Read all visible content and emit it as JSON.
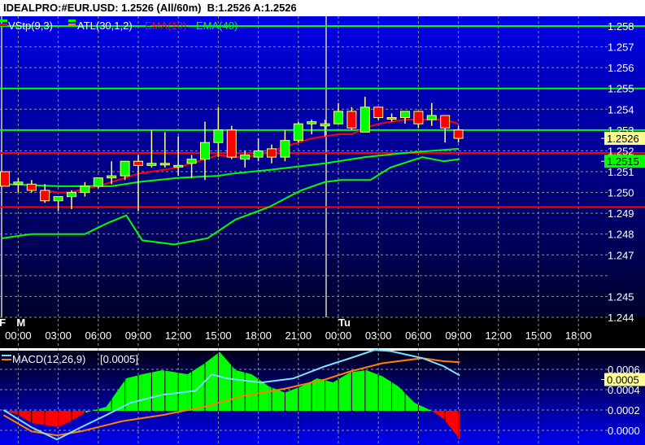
{
  "title": "IDEALPRO:#EUR.USD: 1.2526 (All/60m)  B:1.2526 A:1.2526",
  "legend": {
    "vstp": "VStp(9,3)",
    "atl": "ATL(30,1,2)",
    "ema10": "EMA(10)",
    "ema40": "EMA(40)"
  },
  "colors": {
    "bull": "#00ff00",
    "bear": "#ff0000",
    "wick": "#ffff80",
    "ema10": "#ff0000",
    "green_line": "#00ff00",
    "macd": "#80e0ff",
    "signal": "#ff8000",
    "price_tag": "#ffff90",
    "atl_tag": "#00ff00"
  },
  "price_axis": {
    "labels": [
      "1.258",
      "1.257",
      "1.256",
      "1.255",
      "1.254",
      "1.253",
      "1.252",
      "1.251",
      "1.250",
      "1.249",
      "1.248",
      "1.247",
      "1.245",
      "1.244"
    ],
    "range": [
      1.244,
      1.258
    ],
    "current_price": "1.2526",
    "atl_value": "1.2515"
  },
  "hlines": [
    {
      "price": 1.258,
      "color": "#00ff00"
    },
    {
      "price": 1.255,
      "color": "#00ff00"
    },
    {
      "price": 1.253,
      "color": "#00ff00"
    },
    {
      "price": 1.2519,
      "color": "#ff0000"
    },
    {
      "price": 1.2493,
      "color": "#ff0000"
    }
  ],
  "time_axis": {
    "day_markers": [
      {
        "label": "F",
        "idx": -0.3
      },
      {
        "label": "M",
        "idx": 1
      },
      {
        "label": "Tu",
        "idx": 25
      }
    ],
    "labels": [
      {
        "t": "00:00",
        "idx": 1
      },
      {
        "t": "03:00",
        "idx": 4
      },
      {
        "t": "06:00",
        "idx": 7
      },
      {
        "t": "09:00",
        "idx": 10
      },
      {
        "t": "12:00",
        "idx": 13
      },
      {
        "t": "15:00",
        "idx": 16
      },
      {
        "t": "18:00",
        "idx": 19
      },
      {
        "t": "21:00",
        "idx": 22
      },
      {
        "t": "00:00",
        "idx": 25
      },
      {
        "t": "03:00",
        "idx": 28
      },
      {
        "t": "06:00",
        "idx": 31
      },
      {
        "t": "09:00",
        "idx": 34
      },
      {
        "t": "12:00",
        "idx": 37
      },
      {
        "t": "15:00",
        "idx": 40
      },
      {
        "t": "18:00",
        "idx": 43
      }
    ]
  },
  "candles": [
    [
      1.251,
      1.251,
      1.2503,
      1.2503
    ],
    [
      1.2504,
      1.2507,
      1.25,
      1.2505
    ],
    [
      1.2504,
      1.2506,
      1.25,
      1.2501
    ],
    [
      1.2501,
      1.2504,
      1.2495,
      1.2496
    ],
    [
      1.2496,
      1.2498,
      1.2491,
      1.2498
    ],
    [
      1.2498,
      1.2501,
      1.2492,
      1.25
    ],
    [
      1.25,
      1.2505,
      1.2498,
      1.2503
    ],
    [
      1.2503,
      1.2507,
      1.2502,
      1.2507
    ],
    [
      1.2507,
      1.2515,
      1.2504,
      1.2508
    ],
    [
      1.2508,
      1.2515,
      1.2506,
      1.2515
    ],
    [
      1.2515,
      1.2518,
      1.2491,
      1.2513
    ],
    [
      1.2513,
      1.253,
      1.2512,
      1.2514
    ],
    [
      1.2514,
      1.2529,
      1.2512,
      1.2514
    ],
    [
      1.2513,
      1.2527,
      1.2508,
      1.2513
    ],
    [
      1.2514,
      1.2518,
      1.2507,
      1.2516
    ],
    [
      1.2516,
      1.2534,
      1.2506,
      1.2524
    ],
    [
      1.2524,
      1.2541,
      1.2517,
      1.253
    ],
    [
      1.253,
      1.2532,
      1.2516,
      1.2517
    ],
    [
      1.2516,
      1.252,
      1.2512,
      1.2518
    ],
    [
      1.2517,
      1.2526,
      1.2515,
      1.252
    ],
    [
      1.2521,
      1.2523,
      1.2514,
      1.2517
    ],
    [
      1.2517,
      1.253,
      1.2515,
      1.2525
    ],
    [
      1.2525,
      1.2534,
      1.2524,
      1.2533
    ],
    [
      1.2533,
      1.2535,
      1.2528,
      1.2534
    ],
    [
      1.2532,
      1.2535,
      1.2527,
      1.2533
    ],
    [
      1.2533,
      1.2543,
      1.2533,
      1.2539
    ],
    [
      1.2539,
      1.2541,
      1.253,
      1.2531
    ],
    [
      1.2529,
      1.2546,
      1.2529,
      1.2541
    ],
    [
      1.2541,
      1.2541,
      1.2535,
      1.2536
    ],
    [
      1.2536,
      1.2538,
      1.2534,
      1.2536
    ],
    [
      1.2536,
      1.2539,
      1.2533,
      1.2539
    ],
    [
      1.2539,
      1.2539,
      1.2531,
      1.2533
    ],
    [
      1.2535,
      1.2543,
      1.2532,
      1.2537
    ],
    [
      1.2537,
      1.2537,
      1.2524,
      1.2531
    ],
    [
      1.253,
      1.2532,
      1.2524,
      1.2526
    ]
  ],
  "ema10": [
    [
      3,
      1.2501
    ],
    [
      4,
      1.25
    ],
    [
      5,
      1.25
    ],
    [
      6,
      1.2502
    ],
    [
      7,
      1.2503
    ],
    [
      8,
      1.2505
    ],
    [
      9,
      1.2507
    ],
    [
      10,
      1.2509
    ],
    [
      11,
      1.251
    ],
    [
      12,
      1.2511
    ],
    [
      13,
      1.2512
    ],
    [
      14,
      1.2514
    ],
    [
      15,
      1.2516
    ],
    [
      16,
      1.2518
    ],
    [
      17,
      1.2517
    ],
    [
      18,
      1.2517
    ],
    [
      19,
      1.2518
    ],
    [
      20,
      1.252
    ],
    [
      21,
      1.2522
    ],
    [
      22,
      1.2524
    ],
    [
      23,
      1.2526
    ],
    [
      24,
      1.2527
    ],
    [
      25,
      1.2528
    ],
    [
      26,
      1.2528
    ],
    [
      27,
      1.2531
    ],
    [
      28,
      1.2533
    ],
    [
      29,
      1.2534
    ],
    [
      30,
      1.2535
    ],
    [
      31,
      1.2535
    ],
    [
      32,
      1.2535
    ],
    [
      33,
      1.2535
    ],
    [
      34,
      1.2533
    ]
  ],
  "ema40": [
    [
      0,
      1.2504
    ],
    [
      4,
      1.2503
    ],
    [
      8,
      1.2503
    ],
    [
      10,
      1.2505
    ],
    [
      13,
      1.2507
    ],
    [
      16,
      1.2508
    ],
    [
      17,
      1.2509
    ],
    [
      20,
      1.2511
    ],
    [
      24,
      1.2514
    ],
    [
      27,
      1.2517
    ],
    [
      30,
      1.2519
    ],
    [
      32,
      1.252
    ],
    [
      34,
      1.2521
    ]
  ],
  "vstp": [
    [
      -0.2,
      1.2478
    ],
    [
      2,
      1.248
    ],
    [
      6,
      1.248
    ],
    [
      7.6,
      1.2485
    ],
    [
      9.1,
      1.2489
    ],
    [
      10.3,
      1.2477
    ],
    [
      12.7,
      1.2475
    ],
    [
      15.2,
      1.2478
    ],
    [
      17.3,
      1.2487
    ],
    [
      19.8,
      1.2493
    ],
    [
      22.2,
      1.2501
    ],
    [
      24,
      1.2505
    ],
    [
      25.2,
      1.2506
    ],
    [
      27.4,
      1.2506
    ],
    [
      28.9,
      1.2512
    ],
    [
      31.3,
      1.2517
    ],
    [
      32.9,
      1.2515
    ],
    [
      34.1,
      1.2516
    ]
  ],
  "macd": {
    "label": "MACD(12,26,9)",
    "value": "[0.0005]",
    "axis_labels": [
      "0.0006",
      "0.0004",
      "0.0002",
      "0.0000"
    ],
    "current": "0.0005",
    "range": [
      0.0,
      0.0006
    ],
    "histogram": [
      [
        0,
        0.0
      ],
      [
        1,
        -4e-05
      ],
      [
        2,
        -0.00012
      ],
      [
        4,
        -0.00016
      ],
      [
        5,
        -0.0001
      ],
      [
        6,
        -2e-05
      ],
      [
        7.6,
        4e-05
      ],
      [
        9.1,
        0.00032
      ],
      [
        10.3,
        0.00036
      ],
      [
        11.8,
        0.0004
      ],
      [
        13.7,
        0.00036
      ],
      [
        14.9,
        0.00046
      ],
      [
        16.1,
        0.00058
      ],
      [
        17.3,
        0.0004
      ],
      [
        18.5,
        0.00036
      ],
      [
        19.8,
        0.00024
      ],
      [
        21,
        0.00018
      ],
      [
        22.2,
        0.00024
      ],
      [
        23.4,
        0.00032
      ],
      [
        24.6,
        0.00028
      ],
      [
        25.9,
        0.00038
      ],
      [
        27.1,
        0.0004
      ],
      [
        28.3,
        0.00034
      ],
      [
        29.5,
        0.00024
      ],
      [
        30.7,
        8e-05
      ],
      [
        32,
        0.0
      ],
      [
        32.9,
        -8e-05
      ],
      [
        34.1,
        -0.00028
      ]
    ],
    "macd_line": [
      [
        -0.1,
        0.0002
      ],
      [
        2,
        3e-05
      ],
      [
        3.9,
        -9e-05
      ],
      [
        5.7,
        3e-05
      ],
      [
        7.6,
        0.00015
      ],
      [
        9.4,
        0.00027
      ],
      [
        11.8,
        0.00035
      ],
      [
        14.3,
        0.00039
      ],
      [
        15.5,
        0.00055
      ],
      [
        16.7,
        0.00051
      ],
      [
        19.2,
        0.00047
      ],
      [
        21.6,
        0.00051
      ],
      [
        24,
        0.00063
      ],
      [
        25.9,
        0.00071
      ],
      [
        27.7,
        0.00079
      ],
      [
        28.9,
        0.00078
      ],
      [
        31.3,
        0.00071
      ],
      [
        32.9,
        0.00063
      ],
      [
        34.1,
        0.00054
      ]
    ],
    "signal_line": [
      [
        -0.1,
        0.00015
      ],
      [
        2,
        -1e-05
      ],
      [
        3.9,
        -5e-05
      ],
      [
        5.7,
        -1e-05
      ],
      [
        8.8,
        9e-05
      ],
      [
        11.8,
        0.00015
      ],
      [
        14.9,
        0.00023
      ],
      [
        17.9,
        0.00034
      ],
      [
        21,
        0.00041
      ],
      [
        24,
        0.0005
      ],
      [
        25.9,
        0.00058
      ],
      [
        28.3,
        0.00066
      ],
      [
        31.3,
        0.00071
      ],
      [
        32.9,
        0.00068
      ],
      [
        34.1,
        0.00067
      ]
    ]
  }
}
